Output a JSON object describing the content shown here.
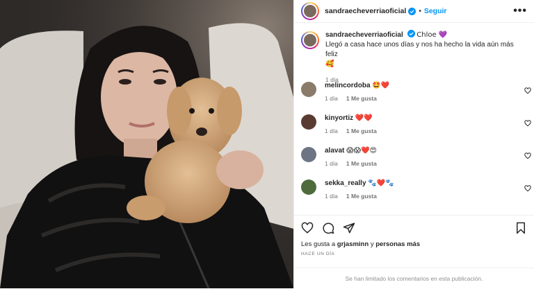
{
  "post": {
    "image_alt": "Woman in black puffer jacket holding a fluffy apricot poodle puppy"
  },
  "header": {
    "username": "sandraecheverriaoficial",
    "separator": "•",
    "follow_label": "Seguir",
    "more_label": "•••"
  },
  "caption": {
    "username": "sandraecheverriaoficial",
    "text_line1": "Chloe 💜",
    "text_line2": "Llegó a casa hace unos días y nos ha hecho la vida aún más feliz",
    "text_emoji": "🥰",
    "time": "1 día"
  },
  "comments": [
    {
      "username": "melincordoba",
      "text": "🤩❤️",
      "time": "1 día",
      "likes": "1 Me gusta",
      "avatar_color": "#8a7b6a"
    },
    {
      "username": "kinyortiz",
      "text": "❤️❤️",
      "time": "1 día",
      "likes": "1 Me gusta",
      "avatar_color": "#5a3b32"
    },
    {
      "username": "alavat",
      "text": "😱😱❤️😍",
      "time": "1 día",
      "likes": "1 Me gusta",
      "avatar_color": "#6d7484"
    },
    {
      "username": "sekka_really",
      "text": "🐾❤️🐾",
      "time": "1 día",
      "likes": "1 Me gusta",
      "avatar_color": "#4e6b3c"
    }
  ],
  "likes_summary": {
    "prefix": "Les gusta a",
    "user": "grjasminn",
    "middle": "y",
    "others": "personas más"
  },
  "posted_ago": "HACE UN DÍA",
  "footer_text": "Se han limitado los comentarios en esta publicación.",
  "colors": {
    "accent": "#0095f6",
    "verified": "#0095f6",
    "muted": "#737373"
  }
}
